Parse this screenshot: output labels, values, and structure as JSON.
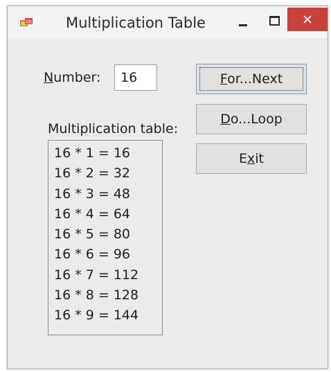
{
  "window": {
    "title": "Multiplication Table"
  },
  "titlebar": {
    "app_icon": "app-form-icon",
    "minimize_icon": "minimize-icon",
    "maximize_icon": "maximize-icon",
    "close_icon": "close-icon",
    "close_color": "#c7423c"
  },
  "form": {
    "number_label_access_key": "N",
    "number_label_rest": "umber:",
    "number_value": "16",
    "table_label": "Multiplication table:",
    "table_items": [
      "16 * 1 = 16",
      "16 * 2 = 32",
      "16 * 3 = 48",
      "16 * 4 = 64",
      "16 * 5 = 80",
      "16 * 6 = 96",
      "16 * 7 = 112",
      "16 * 8 = 128",
      "16 * 9 = 144"
    ]
  },
  "buttons": {
    "for_next": {
      "access_key": "F",
      "rest": "or...Next"
    },
    "do_loop": {
      "access_key": "D",
      "rest": "o...Loop"
    },
    "exit": {
      "pre": "E",
      "access_key": "x",
      "rest": "it"
    }
  }
}
